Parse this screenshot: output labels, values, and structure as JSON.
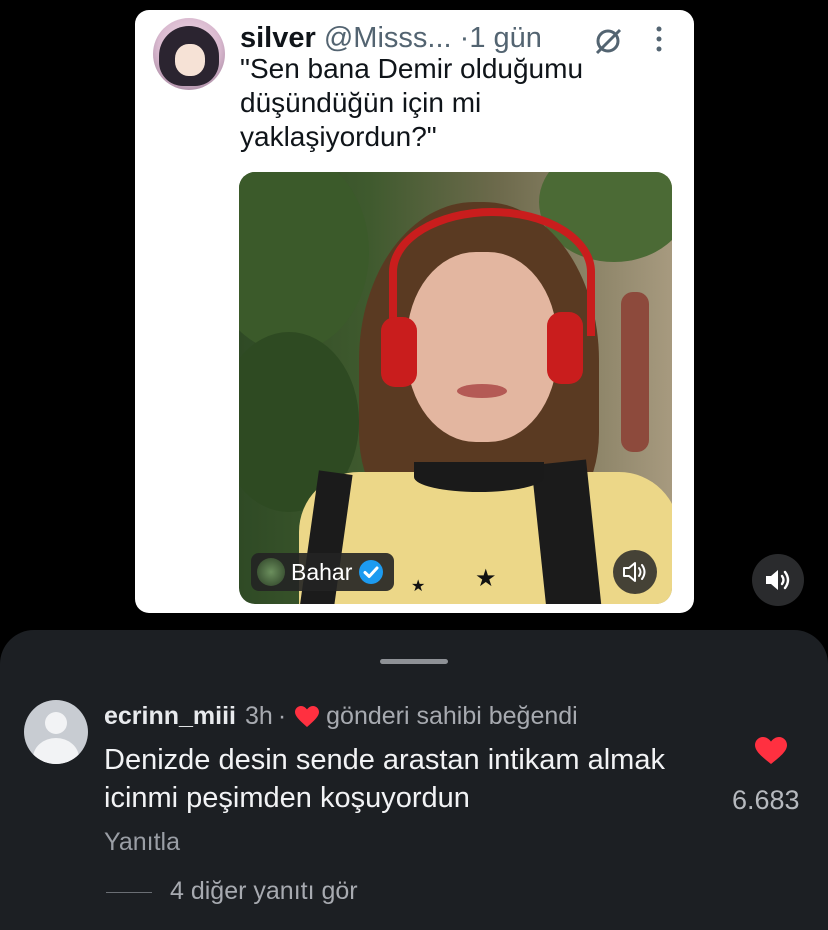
{
  "tweet": {
    "name": "silver",
    "handle": "@Misss...",
    "dot": "·",
    "time": "1 gün",
    "text": "\"Sen bana Demir olduğumu düşündüğün için mi yaklaşiyordun?\"",
    "media_tag": "Bahar"
  },
  "comment": {
    "username": "ecrinn_miii",
    "time": "3h",
    "separator": "·",
    "liked_by_author": "gönderi sahibi beğendi",
    "text": "Denizde desin sende arastan intikam almak icinmi peşimden koşuyordun",
    "reply_label": "Yanıtla",
    "more_replies": "4 diğer yanıtı gör",
    "like_count": "6.683"
  },
  "colors": {
    "like_red": "#ff3040",
    "panel_bg": "#1c1f23",
    "verified_blue": "#1d9bf0"
  },
  "icons": [
    "grok-icon",
    "more-icon",
    "verified-icon",
    "volume-icon",
    "heart-icon",
    "avatar-placeholder-icon"
  ]
}
